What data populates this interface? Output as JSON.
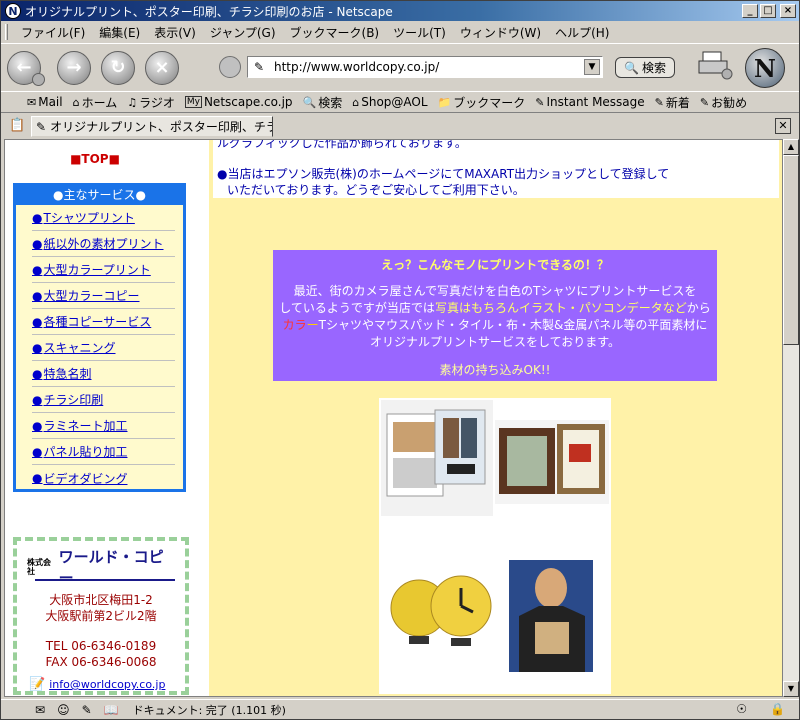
{
  "window": {
    "title": "オリジナルプリント、ポスター印刷、チラシ印刷のお店 - Netscape",
    "minimize": "_",
    "maximize": "□",
    "close": "×"
  },
  "menu": [
    "ファイル(F)",
    "編集(E)",
    "表示(V)",
    "ジャンプ(G)",
    "ブックマーク(B)",
    "ツール(T)",
    "ウィンドウ(W)",
    "ヘルプ(H)"
  ],
  "navbar": {
    "url": "http://www.worldcopy.co.jp/",
    "search_label": "検索"
  },
  "personal_bar": [
    {
      "icon": "mail-icon",
      "label": "Mail"
    },
    {
      "icon": "home-icon",
      "label": "ホーム"
    },
    {
      "icon": "radio-icon",
      "label": "ラジオ"
    },
    {
      "icon": "my-icon",
      "label": "Netscape.co.jp"
    },
    {
      "icon": "search-icon",
      "label": "検索"
    },
    {
      "icon": "shop-icon",
      "label": "Shop@AOL"
    },
    {
      "icon": "bookmark-icon",
      "label": "ブックマーク"
    },
    {
      "icon": "link-icon",
      "label": "Instant Message"
    },
    {
      "icon": "link-icon",
      "label": "新着"
    },
    {
      "icon": "link-icon",
      "label": "お勧め"
    }
  ],
  "tab": {
    "label": "オリジナルプリント、ポスター印刷、チラシ印刷..."
  },
  "page": {
    "top_link": "■TOP■",
    "services_header": "●主なサービス●",
    "services": [
      "Tシャツプリント",
      "紙以外の素材プリント",
      "大型カラープリント",
      "大型カラーコピー",
      "各種コピーサービス",
      "スキャニング",
      "特急名刺",
      "チラシ印刷",
      "ラミネート加工",
      "パネル貼り加工",
      "ビデオダビング"
    ],
    "company": {
      "logo_prefix": "株式会社",
      "logo_name": "ワールド・コピー",
      "addr1": "大阪市北区梅田1-2",
      "addr2": "大阪駅前第2ビル2階",
      "tel": "TEL 06-6346-0189",
      "fax": "FAX 06-6346-0068",
      "email": "info@worldcopy.co.jp"
    },
    "notice_cut": "ルグラフィックした作品が飾られております。",
    "notice_line1": "●当店はエプソン販売(株)のホームページにてMAXART出力ショップとして登録して",
    "notice_line2": "いただいております。どうぞご安心してご利用下さい。",
    "promo": {
      "heading": "えっ？こんなモノにプリントできるの！？",
      "l1": "最近、街のカメラ屋さんで写真だけを白色のTシャツにプリントサービスを",
      "l2a": "しているようですが当店では",
      "l2b": "写真はもちろんイラスト・パソコンデータなど",
      "l2c": "から",
      "l3a": "カラ",
      "l3b": "ー",
      "l3c": "Tシャツやマウスパッド・タイル・布・木製&金属パネル等の平面素材に",
      "l4": "オリジナルプリントサービスをしております。",
      "l5": "素材の持ち込みOK!!"
    }
  },
  "status": {
    "text": "ドキュメント: 完了 (1.101 秒)"
  }
}
